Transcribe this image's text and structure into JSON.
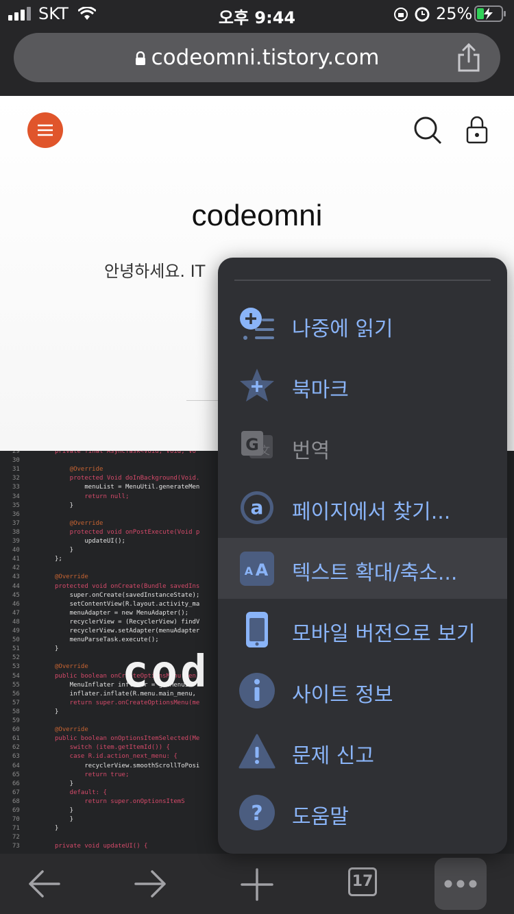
{
  "status_bar": {
    "carrier": "SKT",
    "time": "오후 9:44",
    "battery": "25%"
  },
  "address_bar": {
    "url": "codeomni.tistory.com"
  },
  "page": {
    "title": "codeomni",
    "intro": "안녕하세요. IT "
  },
  "code_image": {
    "caption_text": "cod",
    "line_numbers": [
      "29",
      "30",
      "31",
      "32",
      "33",
      "34",
      "35",
      "36",
      "37",
      "38",
      "39",
      "40",
      "41",
      "42",
      "43",
      "44",
      "45",
      "46",
      "47",
      "48",
      "49",
      "50",
      "51",
      "52",
      "53",
      "54",
      "55",
      "56",
      "57",
      "58",
      "59",
      "60",
      "61",
      "62",
      "63",
      "64",
      "65",
      "66",
      "67",
      "68",
      "69",
      "70",
      "71",
      "72",
      "73"
    ],
    "lines": [
      "private final AsyncTask<Void, Void, Vo",
      "",
      "    @Override",
      "    protected Void doInBackground(Void.",
      "        menuList = MenuUtil.generateMen",
      "        return null;",
      "    }",
      "",
      "    @Override",
      "    protected void onPostExecute(Void p",
      "        updateUI();",
      "    }",
      "};",
      "",
      "@Override",
      "protected void onCreate(Bundle savedIns",
      "    super.onCreate(savedInstanceState);",
      "    setContentView(R.layout.activity_ma",
      "    menuAdapter = new MenuAdapter();",
      "    recyclerView = (RecyclerView) findV",
      "    recyclerView.setAdapter(menuAdapter",
      "    menuParseTask.execute();",
      "}",
      "",
      "@Override",
      "public boolean onCreateOptionsMenu(Men",
      "    MenuInflater inflater = getMenuIn",
      "    inflater.inflate(R.menu.main_menu,",
      "    return super.onCreateOptionsMenu(me",
      "}",
      "",
      "@Override",
      "public boolean onOptionsItemSelected(Me",
      "    switch (item.getItemId()) {",
      "    case R.id.action_next_menu: {",
      "        recyclerView.smoothScrollToPosi",
      "        return true;",
      "    }",
      "    default: {",
      "        return super.onOptionsItemS",
      "    }",
      "    }",
      "}",
      "",
      "private void updateUI() {"
    ]
  },
  "menu": {
    "items": [
      {
        "label": "나중에 읽기",
        "icon": "read-later-icon",
        "enabled": true
      },
      {
        "label": "북마크",
        "icon": "bookmark-star-icon",
        "enabled": true
      },
      {
        "label": "번역",
        "icon": "translate-icon",
        "enabled": false
      },
      {
        "label": "페이지에서 찾기...",
        "icon": "find-in-page-icon",
        "enabled": true
      },
      {
        "label": "텍스트 확대/축소...",
        "icon": "text-zoom-icon",
        "enabled": true,
        "highlighted": true
      },
      {
        "label": "모바일 버전으로 보기",
        "icon": "mobile-site-icon",
        "enabled": true
      },
      {
        "label": "사이트 정보",
        "icon": "info-icon",
        "enabled": true
      },
      {
        "label": "문제 신고",
        "icon": "warning-icon",
        "enabled": true
      },
      {
        "label": "도움말",
        "icon": "help-icon",
        "enabled": true
      }
    ]
  },
  "toolbar": {
    "tab_count": "17"
  },
  "colors": {
    "accent": "#8ab4f8",
    "menu_bg": "#2f3034",
    "brand": "#e0552b"
  }
}
